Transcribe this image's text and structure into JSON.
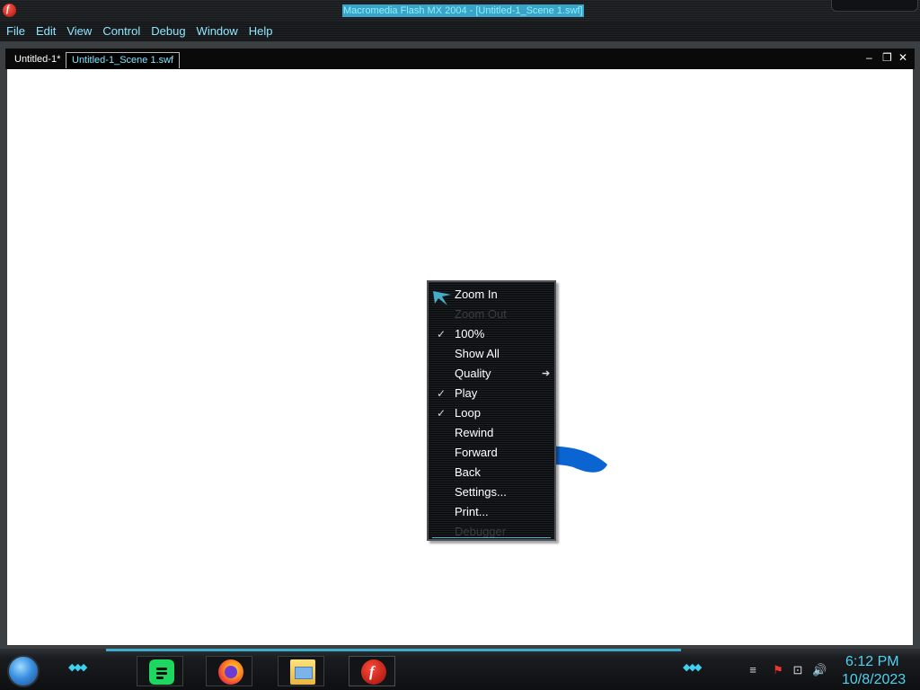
{
  "window": {
    "title": "Macromedia Flash MX 2004 - [Untitled-1_Scene 1.swf]",
    "app_icon": "flash-icon",
    "app_icon_glyph": "f"
  },
  "menubar": {
    "items": [
      {
        "label": "File"
      },
      {
        "label": "Edit"
      },
      {
        "label": "View"
      },
      {
        "label": "Control"
      },
      {
        "label": "Debug"
      },
      {
        "label": "Window"
      },
      {
        "label": "Help"
      }
    ]
  },
  "document": {
    "tabs": [
      {
        "label": "Untitled-1*",
        "active": false
      },
      {
        "label": "Untitled-1_Scene 1.swf",
        "active": true
      }
    ],
    "controls": {
      "minimize": "–",
      "restore": "❐",
      "close": "✕"
    },
    "stage_color": "#ffffff",
    "shape_color": "#0a64d2"
  },
  "context_menu": {
    "items": [
      {
        "label": "Zoom In",
        "enabled": true,
        "checked": false,
        "submenu": false
      },
      {
        "label": "Zoom Out",
        "enabled": false,
        "checked": false,
        "submenu": false
      },
      {
        "label": "100%",
        "enabled": true,
        "checked": true,
        "submenu": false
      },
      {
        "label": "Show All",
        "enabled": true,
        "checked": false,
        "submenu": false
      },
      {
        "label": "Quality",
        "enabled": true,
        "checked": false,
        "submenu": true
      },
      {
        "label": "Play",
        "enabled": true,
        "checked": true,
        "submenu": false
      },
      {
        "label": "Loop",
        "enabled": true,
        "checked": true,
        "submenu": false
      },
      {
        "label": "Rewind",
        "enabled": true,
        "checked": false,
        "submenu": false
      },
      {
        "label": "Forward",
        "enabled": true,
        "checked": false,
        "submenu": false
      },
      {
        "label": "Back",
        "enabled": true,
        "checked": false,
        "submenu": false
      },
      {
        "label": "Settings...",
        "enabled": true,
        "checked": false,
        "submenu": false
      },
      {
        "label": "Print...",
        "enabled": true,
        "checked": false,
        "submenu": false
      },
      {
        "label": "Debugger",
        "enabled": false,
        "checked": false,
        "submenu": false
      }
    ],
    "check_glyph": "✓",
    "submenu_glyph": "➔"
  },
  "taskbar": {
    "accent_color": "#3aaecb",
    "apps": [
      {
        "name": "spotify",
        "icon": "spotify-icon"
      },
      {
        "name": "firefox",
        "icon": "firefox-icon"
      },
      {
        "name": "file-explorer",
        "icon": "folder-icon"
      },
      {
        "name": "flash",
        "icon": "flash-icon"
      }
    ],
    "tray": {
      "icons": [
        "action-center-flag-icon",
        "network-icon",
        "volume-icon"
      ]
    },
    "clock": {
      "time": "6:12 PM",
      "date": "10/8/2023"
    }
  }
}
